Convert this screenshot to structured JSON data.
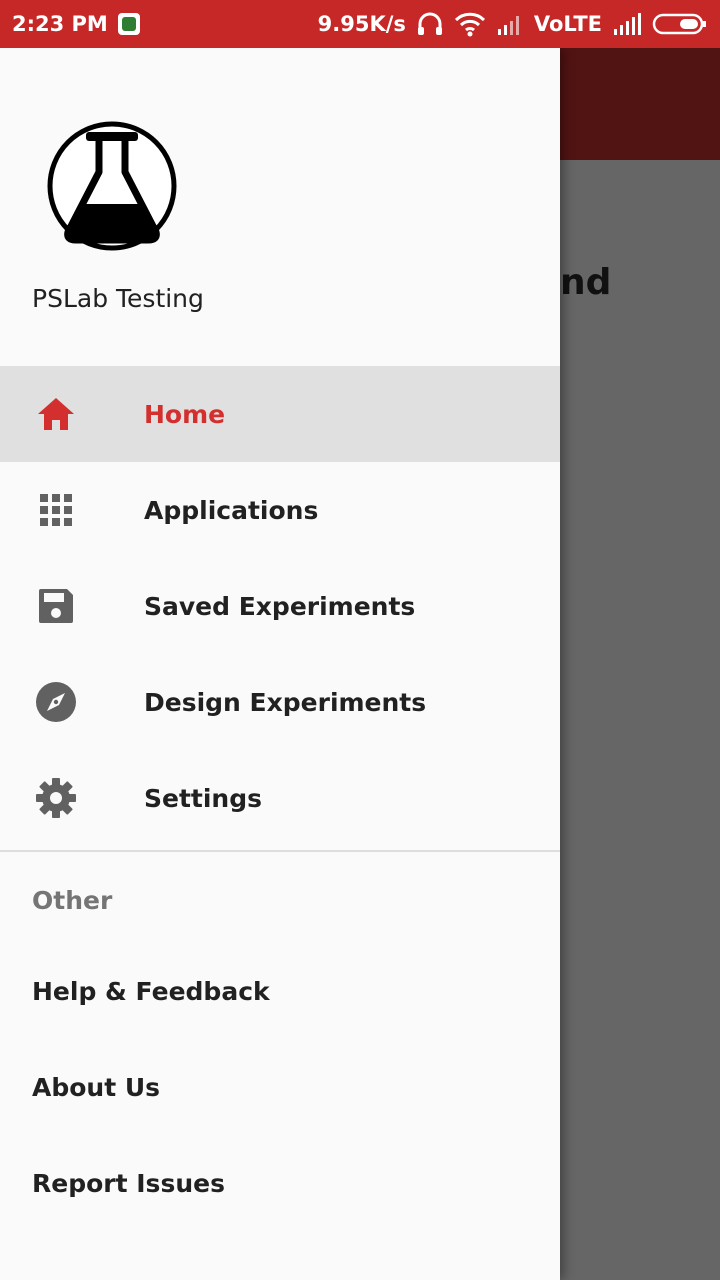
{
  "status_bar": {
    "time": "2:23 PM",
    "net_speed": "9.95K/s",
    "volte": "VoLTE",
    "icons": [
      "saavn-app-icon",
      "headset-icon",
      "wifi-icon",
      "signal-icon",
      "signal-icon",
      "battery-icon"
    ]
  },
  "background": {
    "fragment_text": "nd"
  },
  "drawer": {
    "title": "PSLab Testing",
    "logo_icon": "flask-icon",
    "accent_color": "#d32f2f",
    "items": [
      {
        "label": "Home",
        "icon": "home-icon",
        "active": true
      },
      {
        "label": "Applications",
        "icon": "apps-grid-icon",
        "active": false
      },
      {
        "label": "Saved Experiments",
        "icon": "save-icon",
        "active": false
      },
      {
        "label": "Design Experiments",
        "icon": "compass-icon",
        "active": false
      },
      {
        "label": "Settings",
        "icon": "gear-icon",
        "active": false
      }
    ],
    "other_header": "Other",
    "other_items": [
      {
        "label": "Help & Feedback"
      },
      {
        "label": "About Us"
      },
      {
        "label": "Report Issues"
      }
    ]
  }
}
